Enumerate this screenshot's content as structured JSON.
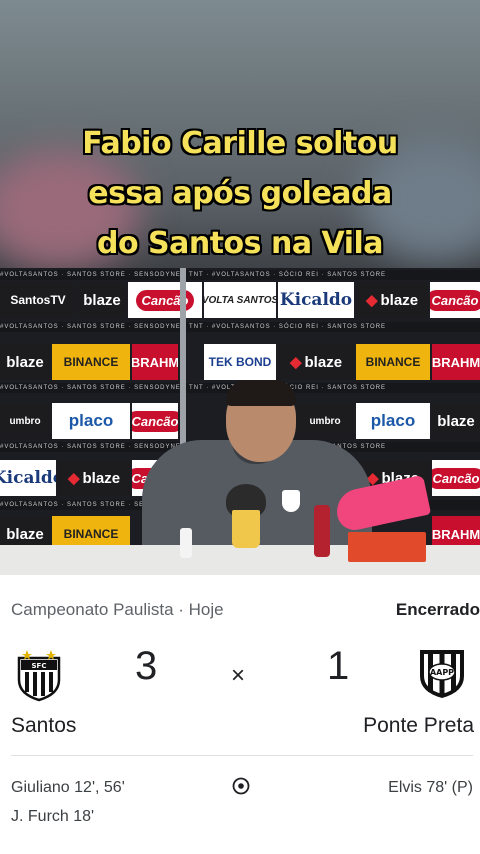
{
  "caption": {
    "line1": "Fabio Carille soltou",
    "line2": "essa após goleada",
    "line3": "do Santos na Vila"
  },
  "backdrop": {
    "strip_text": "#VOLTASANTOS  ·  SANTOS STORE  ·  SENSODYNE  ·  TNT  ·  #VOLTASANTOS  ·  SÓCIO REI  ·  SANTOS STORE",
    "sponsors": {
      "santostv": "SantosTV",
      "blaze": "blaze",
      "canc": "Cancão",
      "volta": "VOLTA SANTOS",
      "kicaldo": "Kicaldo",
      "binance": "BINANCE",
      "brahma": "BRAHM",
      "tekbond": "TEK BOND",
      "placo": "placo",
      "umbro": "umbro"
    }
  },
  "match": {
    "competition": "Campeonato Paulista · Hoje",
    "status": "Encerrado",
    "home": {
      "name": "Santos",
      "score": "3",
      "crest_icon": "santos-crest-icon"
    },
    "away": {
      "name": "Ponte Preta",
      "score": "1",
      "crest_icon": "ponte-preta-crest-icon"
    },
    "separator": "×",
    "home_scorers": [
      "Giuliano 12', 56'",
      "J. Furch 18'"
    ],
    "away_scorers": [
      "Elvis 78' (P)"
    ],
    "goal_icon": "soccer-ball-icon"
  },
  "colors": {
    "caption": "#f6e15a",
    "text_primary": "#202124",
    "text_secondary": "#5f6368"
  }
}
